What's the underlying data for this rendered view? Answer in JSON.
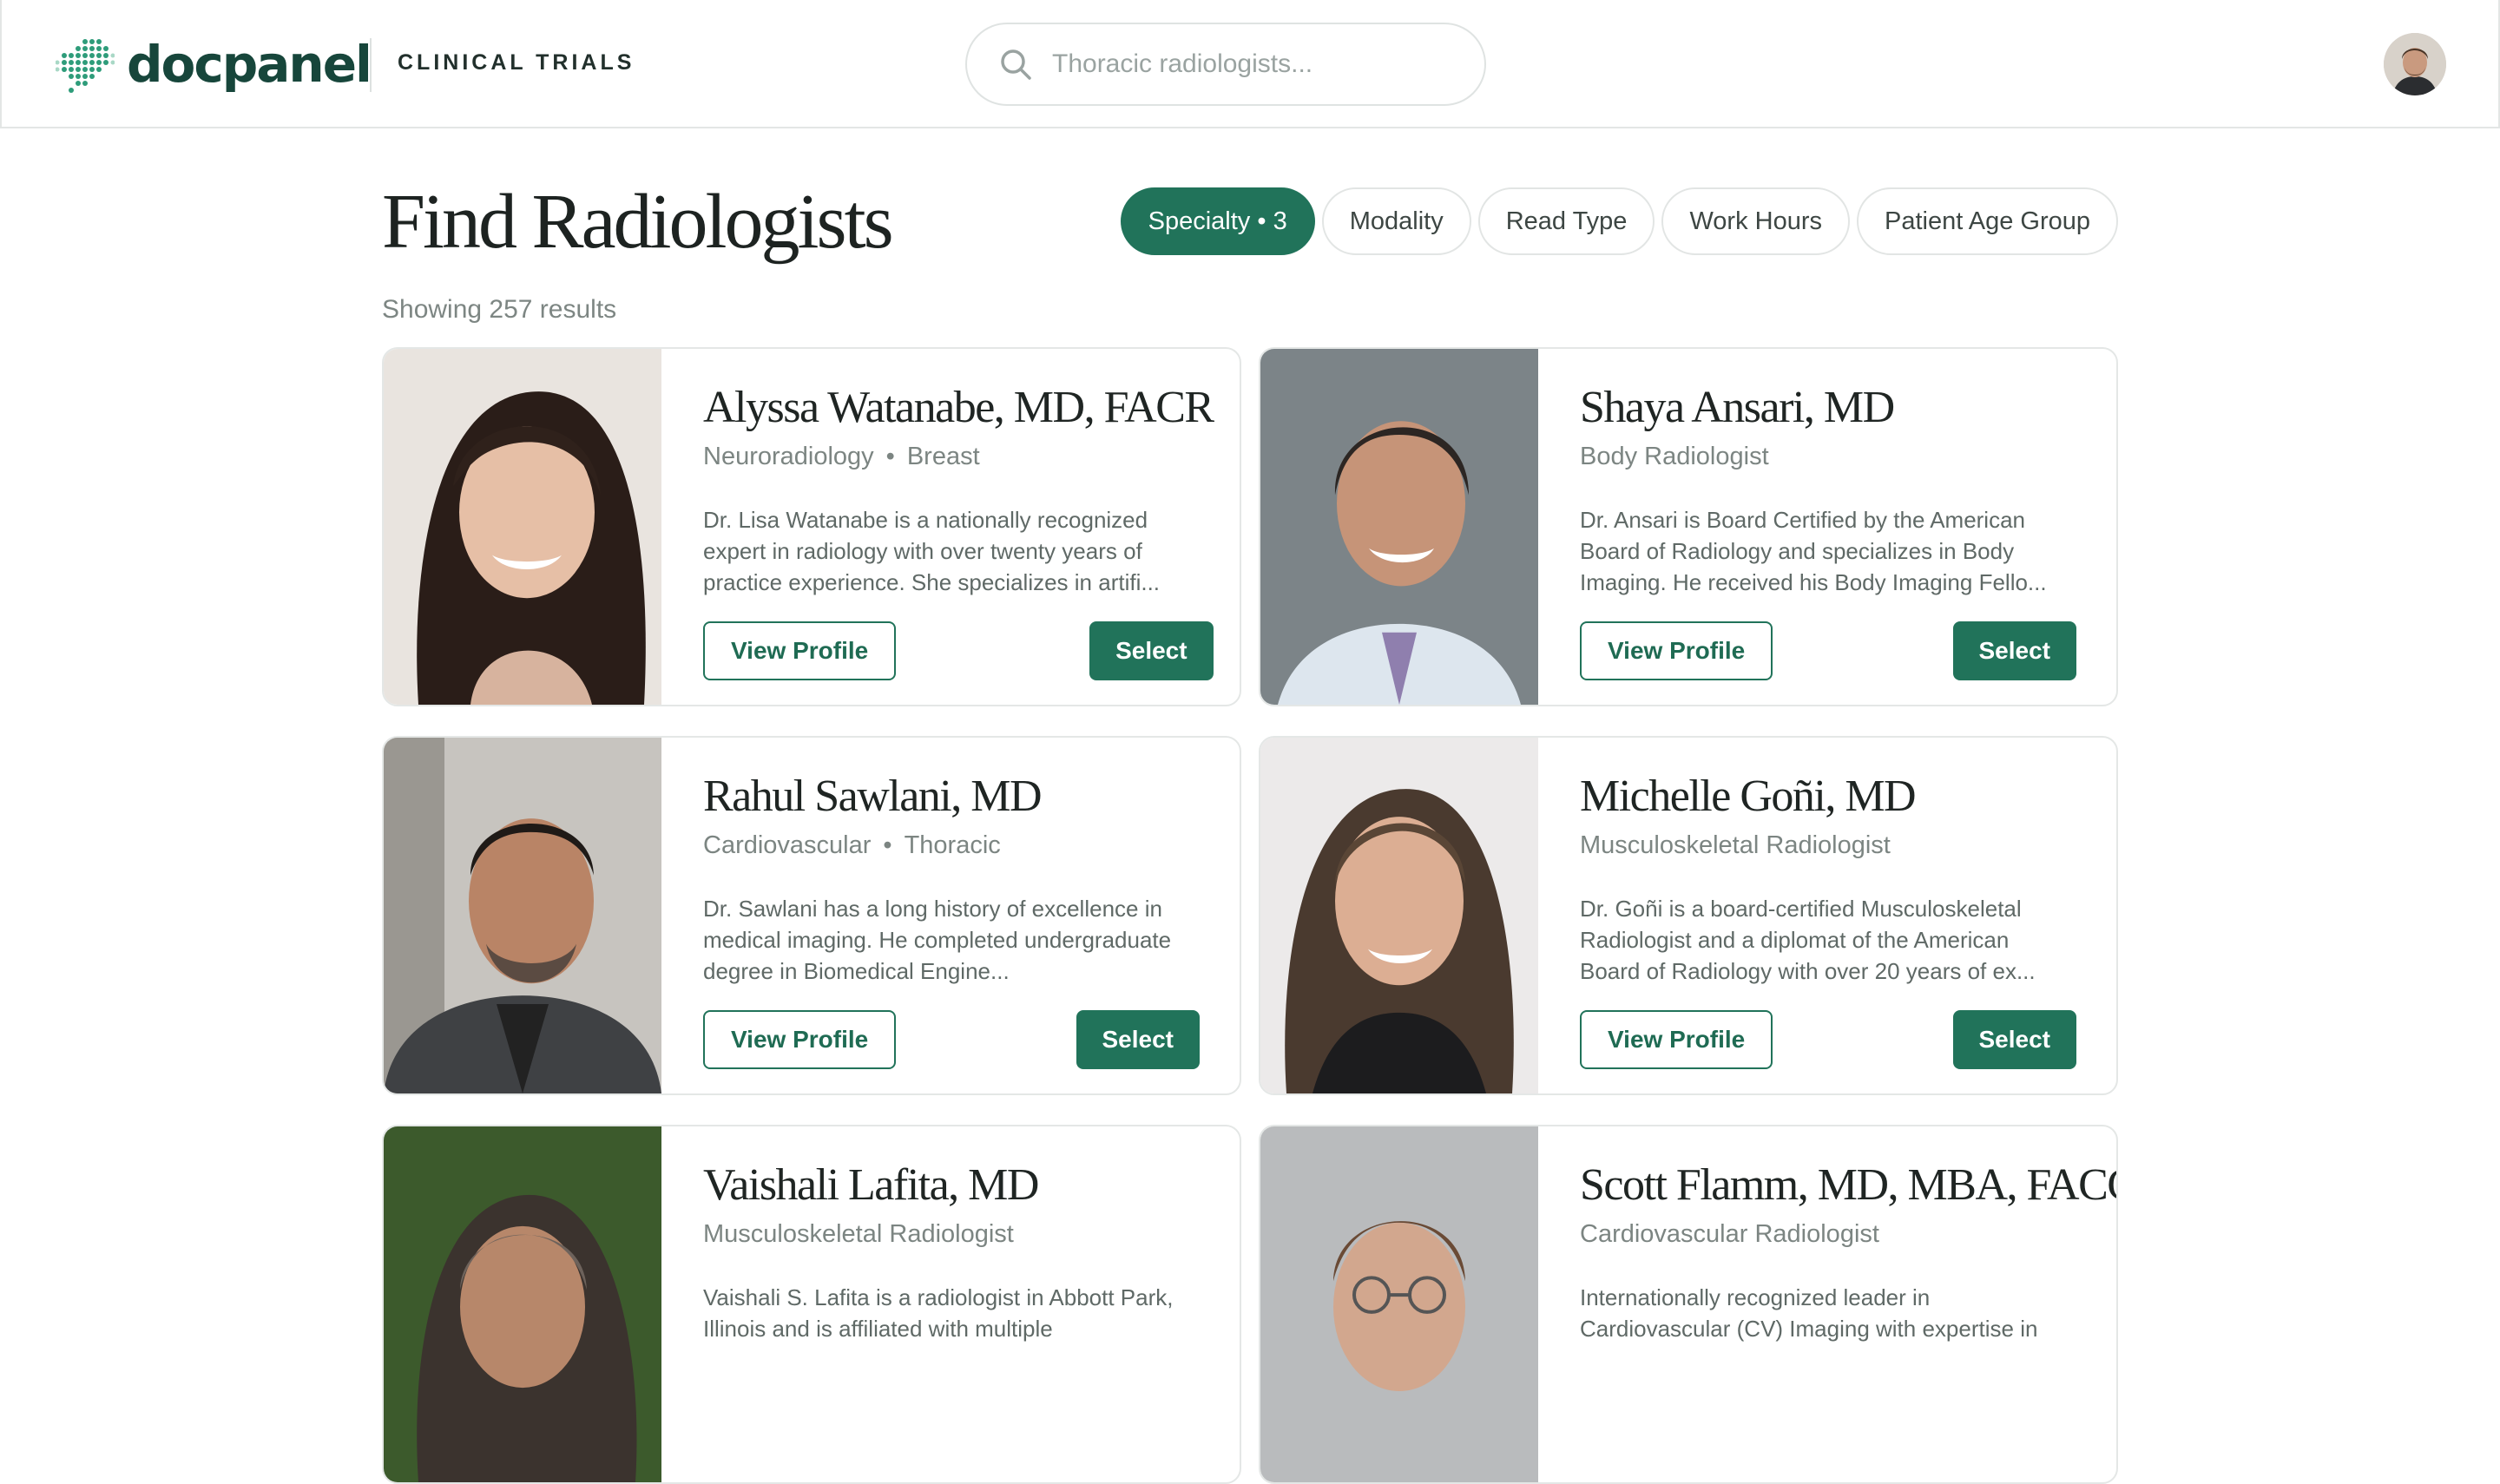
{
  "brand": {
    "name": "docpanel",
    "section": "CLINICAL TRIALS"
  },
  "search": {
    "placeholder": "Thoracic radiologists..."
  },
  "page": {
    "title": "Find Radiologists",
    "results_text": "Showing 257 results"
  },
  "filters": [
    {
      "label": "Specialty • 3",
      "active": true
    },
    {
      "label": "Modality",
      "active": false
    },
    {
      "label": "Read Type",
      "active": false
    },
    {
      "label": "Work Hours",
      "active": false
    },
    {
      "label": "Patient Age Group",
      "active": false
    }
  ],
  "actions": {
    "view_profile": "View Profile",
    "select": "Select"
  },
  "doctors": [
    {
      "name": "Alyssa Watanabe, MD, FACR",
      "specialties": [
        "Neuroradiology",
        "Breast"
      ],
      "bio": "Dr. Lisa Watanabe is a nationally recognized expert in radiology with over twenty years of practice experience. She specializes in artifi..."
    },
    {
      "name": "Shaya Ansari, MD",
      "specialties": [
        "Body Radiologist"
      ],
      "bio": "Dr. Ansari is Board Certified by the American Board of Radiology and specializes in Body Imaging. He received his Body Imaging Fello..."
    },
    {
      "name": "Rahul Sawlani, MD",
      "specialties": [
        "Cardiovascular",
        "Thoracic"
      ],
      "bio": "Dr. Sawlani has a long history of excellence in medical imaging. He completed undergraduate degree in Biomedical Engine..."
    },
    {
      "name": "Michelle Goñi, MD",
      "specialties": [
        "Musculoskeletal Radiologist"
      ],
      "bio": "Dr. Goñi is a board-certified Musculoskeletal Radiologist and a diplomat of the American Board of Radiology with over 20 years of ex..."
    },
    {
      "name": "Vaishali Lafita, MD",
      "specialties": [
        "Musculoskeletal Radiologist"
      ],
      "bio": "Vaishali S. Lafita is a radiologist in Abbott Park, Illinois and is affiliated with multiple"
    },
    {
      "name": "Scott Flamm, MD, MBA, FACC",
      "specialties": [
        "Cardiovascular Radiologist"
      ],
      "bio": "Internationally recognized leader in Cardiovascular (CV) Imaging with expertise in"
    }
  ],
  "colors": {
    "brand_green": "#21735a",
    "logo_text": "#17463b",
    "border": "#e4e7e6"
  }
}
